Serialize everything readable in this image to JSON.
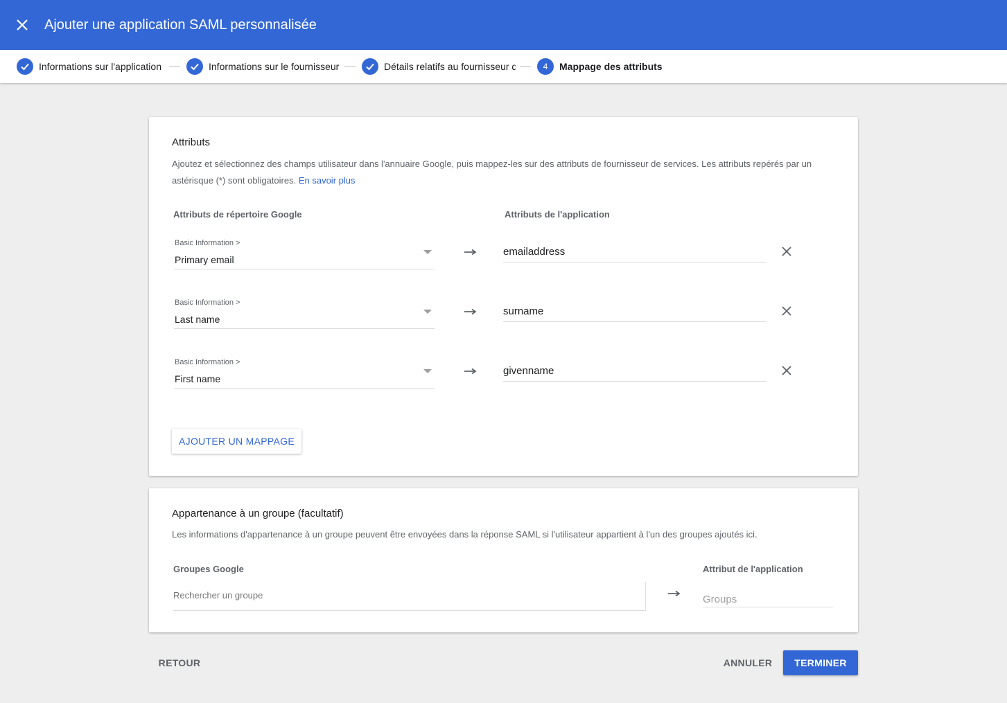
{
  "header": {
    "title": "Ajouter une application SAML personnalisée"
  },
  "stepper": {
    "steps": [
      {
        "label": "Informations sur l'application",
        "status": "done"
      },
      {
        "label": "Informations sur le fournisseur d'identité Google",
        "status": "done"
      },
      {
        "label": "Détails relatifs au fournisseur de services",
        "status": "done"
      },
      {
        "label": "Mappage des attributs",
        "status": "active",
        "number": "4"
      }
    ]
  },
  "attributes": {
    "title": "Attributs",
    "description": "Ajoutez et sélectionnez des champs utilisateur dans l'annuaire Google, puis mappez-les sur des attributs de fournisseur de services. Les attributs repérés par un astérisque (*) sont obligatoires.",
    "learn_more": "En savoir plus",
    "col_google": "Attributs de répertoire Google",
    "col_app": "Attributs de l'application",
    "mappings": [
      {
        "category": "Basic Information >",
        "field": "Primary email",
        "app_attribute": "emailaddress"
      },
      {
        "category": "Basic Information >",
        "field": "Last name",
        "app_attribute": "surname"
      },
      {
        "category": "Basic Information >",
        "field": "First name",
        "app_attribute": "givenname"
      }
    ],
    "add_button": "AJOUTER UN MAPPAGE"
  },
  "group_membership": {
    "title": "Appartenance à un groupe (facultatif)",
    "description": "Les informations d'appartenance à un groupe peuvent être envoyées dans la réponse SAML si l'utilisateur appartient à l'un des groupes ajoutés ici.",
    "col_groups": "Groupes Google",
    "col_app": "Attribut de l'application",
    "search_placeholder": "Rechercher un groupe",
    "app_placeholder": "Groups"
  },
  "footer": {
    "back": "RETOUR",
    "cancel": "ANNULER",
    "finish": "TERMINER"
  },
  "colors": {
    "primary": "#3367d6",
    "background": "#eeeeee"
  }
}
